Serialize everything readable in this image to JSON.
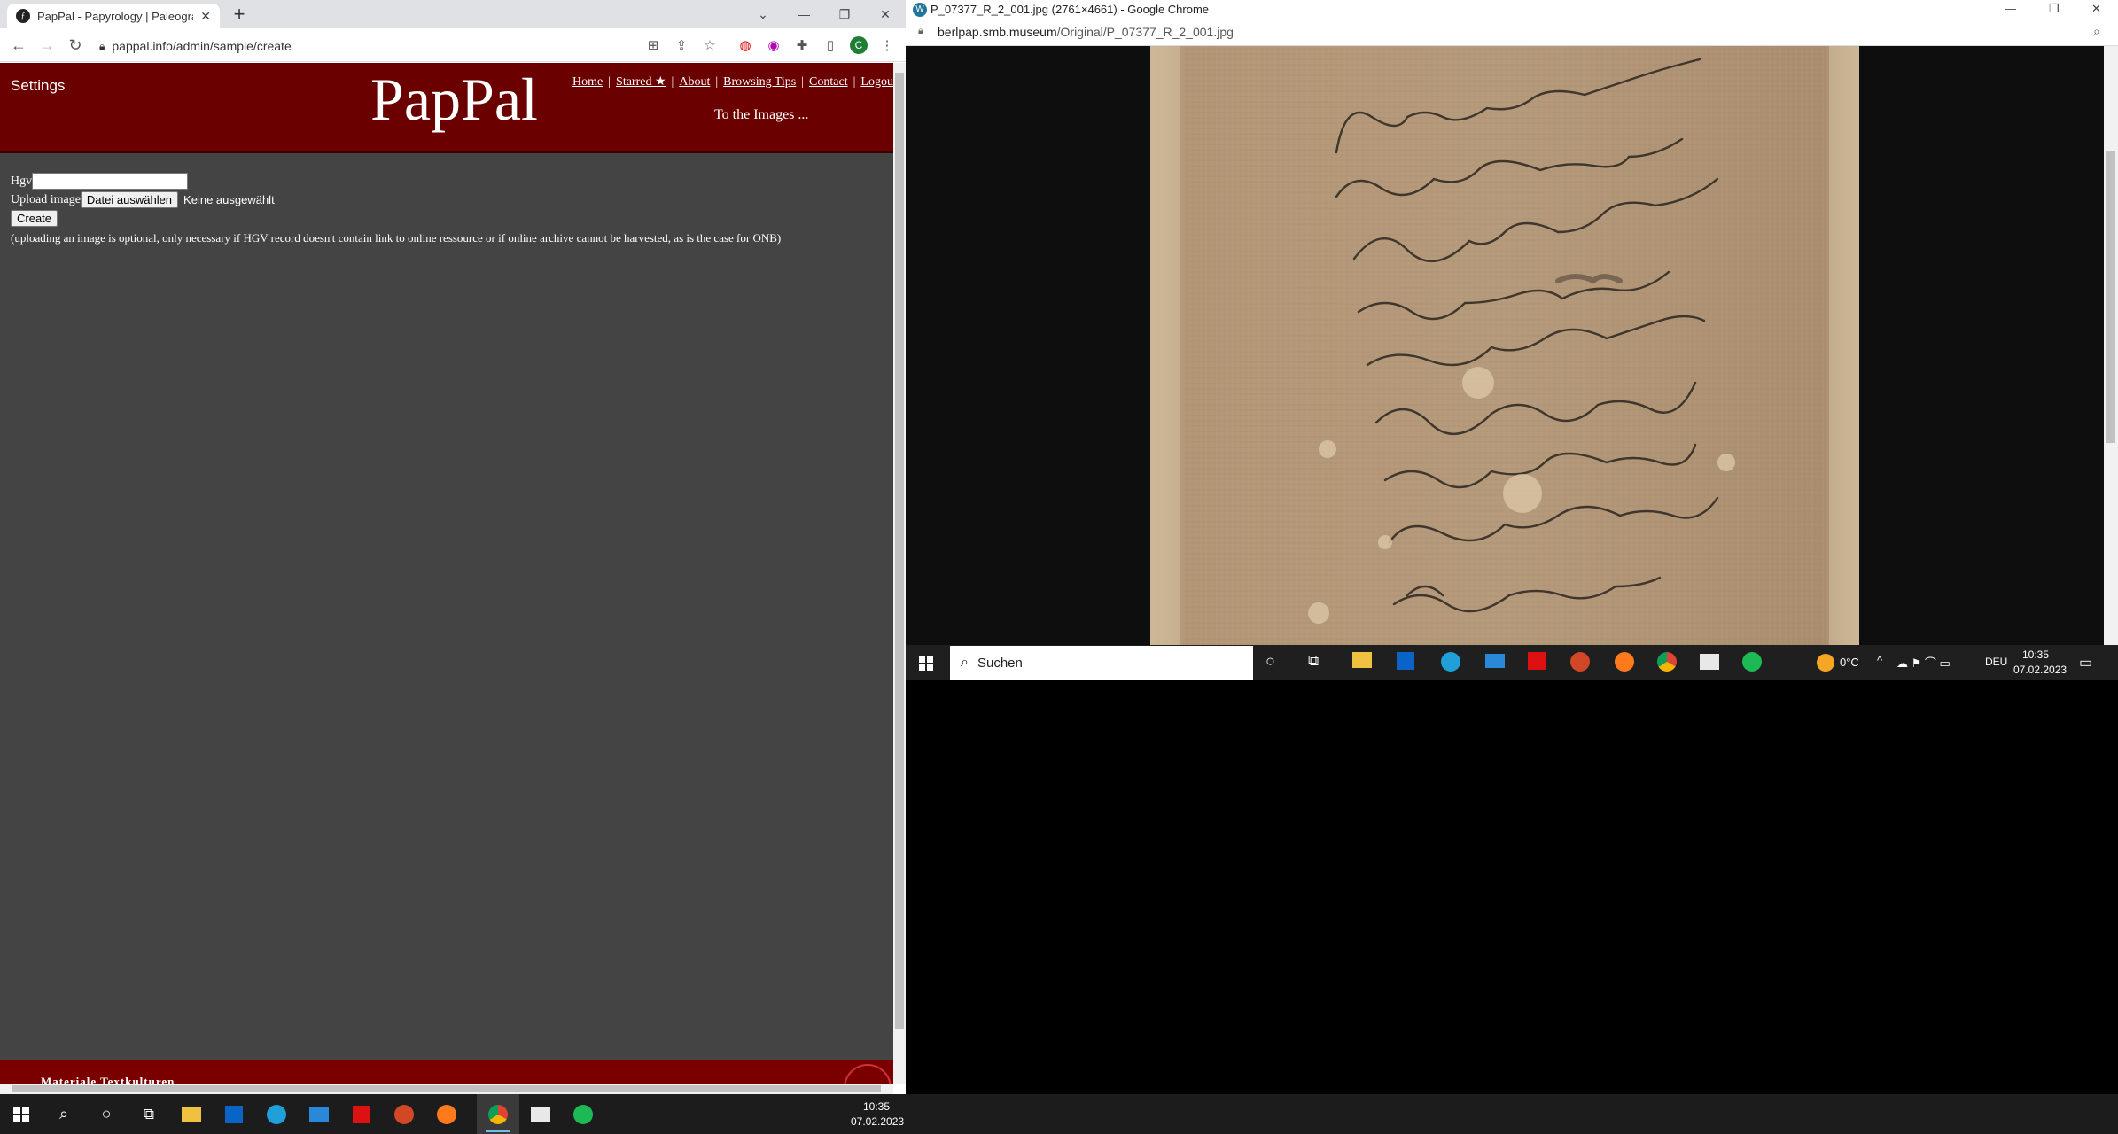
{
  "left_browser": {
    "tab_title": "PapPal - Papyrology | Paleograph",
    "url": "pappal.info/admin/sample/create",
    "profile_initial": "C"
  },
  "pappal": {
    "settings": "Settings",
    "logo": "PapPal",
    "nav": [
      "Home",
      "Starred ★",
      "About",
      "Browsing Tips",
      "Contact",
      "Logout"
    ],
    "to_images": "To the Images ...",
    "form": {
      "hgv_label": "Hgv",
      "upload_label": "Upload image",
      "file_button": "Datei auswählen",
      "no_file": "Keine ausgewählt",
      "create_button": "Create",
      "note": "(uploading an image is optional, only necessary if HGV record doesn't contain link to online ressource or if online archive cannot be harvested, as is the case for ONB)"
    },
    "footer": "Materiale Textkulturen"
  },
  "right_browser": {
    "title": "P_07377_R_2_001.jpg (2761×4661) - Google Chrome",
    "url_host": "berlpap.smb.museum",
    "url_path": "/Original/P_07377_R_2_001.jpg"
  },
  "inner_taskbar": {
    "search": "Suchen",
    "weather": "0°C",
    "lang": "DEU",
    "time": "10:35",
    "date": "07.02.2023"
  },
  "taskbar": {
    "time": "10:35",
    "date": "07.02.2023"
  }
}
